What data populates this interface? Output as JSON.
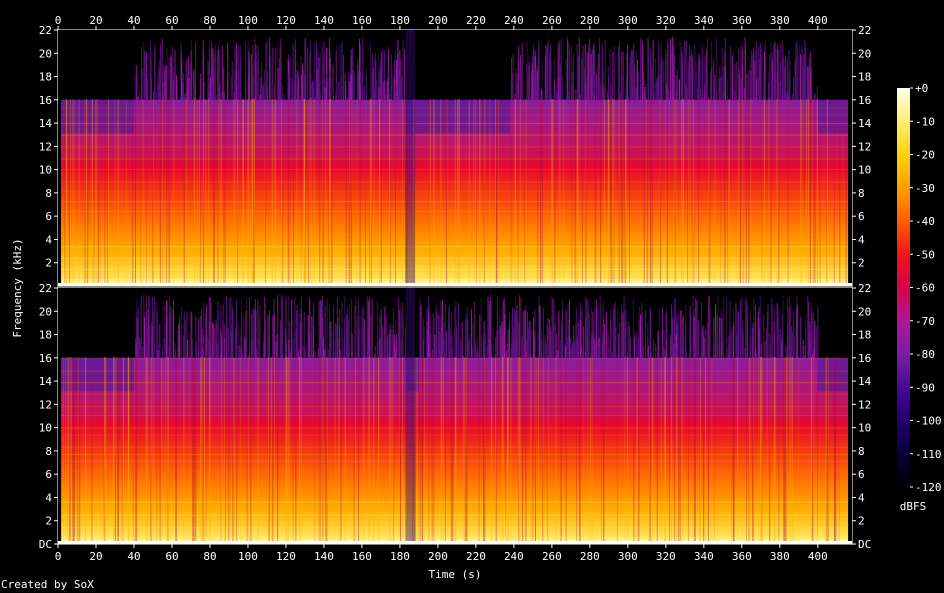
{
  "chart_data": {
    "type": "heatmap",
    "software_credit": "Created by SoX",
    "xlabel": "Time (s)",
    "ylabel": "Frequency (kHz)",
    "colorbar_label": "dBFS",
    "xlim": [
      0,
      418
    ],
    "x_ticks": [
      0,
      20,
      40,
      60,
      80,
      100,
      120,
      140,
      160,
      180,
      200,
      220,
      240,
      260,
      280,
      300,
      320,
      340,
      360,
      380,
      400
    ],
    "ylim_khz": [
      0,
      22
    ],
    "y_ticks": [
      {
        "value": 0,
        "label": "DC"
      },
      {
        "value": 2,
        "label": "2"
      },
      {
        "value": 4,
        "label": "4"
      },
      {
        "value": 6,
        "label": "6"
      },
      {
        "value": 8,
        "label": "8"
      },
      {
        "value": 10,
        "label": "10"
      },
      {
        "value": 12,
        "label": "12"
      },
      {
        "value": 14,
        "label": "14"
      },
      {
        "value": 16,
        "label": "16"
      },
      {
        "value": 18,
        "label": "18"
      },
      {
        "value": 20,
        "label": "20"
      },
      {
        "value": 22,
        "label": "22"
      }
    ],
    "colorbar_ticks": [
      {
        "value": 0,
        "label": "+0"
      },
      {
        "value": -10,
        "label": "-10"
      },
      {
        "value": -20,
        "label": "-20"
      },
      {
        "value": -30,
        "label": "-30"
      },
      {
        "value": -40,
        "label": "-40"
      },
      {
        "value": -50,
        "label": "-50"
      },
      {
        "value": -60,
        "label": "-60"
      },
      {
        "value": -70,
        "label": "-70"
      },
      {
        "value": -80,
        "label": "-80"
      },
      {
        "value": -90,
        "label": "-90"
      },
      {
        "value": -100,
        "label": "-100"
      },
      {
        "value": -110,
        "label": "-110"
      },
      {
        "value": -120,
        "label": "-120"
      }
    ],
    "colormap_stops": [
      {
        "db": -120,
        "color": "#000000"
      },
      {
        "db": -110,
        "color": "#06003a"
      },
      {
        "db": -95,
        "color": "#320088"
      },
      {
        "db": -80,
        "color": "#7a1ca8"
      },
      {
        "db": -70,
        "color": "#b01596"
      },
      {
        "db": -60,
        "color": "#d8004c"
      },
      {
        "db": -50,
        "color": "#f0141c"
      },
      {
        "db": -40,
        "color": "#ff5f00"
      },
      {
        "db": -30,
        "color": "#ffa000"
      },
      {
        "db": -20,
        "color": "#ffd10a"
      },
      {
        "db": -10,
        "color": "#ffee70"
      },
      {
        "db": 0,
        "color": "#fffff0"
      }
    ],
    "channels": [
      {
        "gaps": [
          {
            "from": 0,
            "to": 1.5
          },
          {
            "from": 416,
            "to": 418
          }
        ],
        "bandlimit_khz": [
          {
            "from": 1.5,
            "to": 40,
            "khz": 16
          },
          {
            "from": 40,
            "to": 183,
            "khz": 22
          },
          {
            "from": 183,
            "to": 238,
            "khz": 16
          },
          {
            "from": 238,
            "to": 400,
            "khz": 22
          },
          {
            "from": 400,
            "to": 416,
            "khz": 16
          }
        ]
      },
      {
        "gaps": [
          {
            "from": 0,
            "to": 1.5
          },
          {
            "from": 416,
            "to": 418
          }
        ],
        "bandlimit_khz": [
          {
            "from": 1.5,
            "to": 40,
            "khz": 16
          },
          {
            "from": 40,
            "to": 183,
            "khz": 22
          },
          {
            "from": 183,
            "to": 190,
            "khz": 16
          },
          {
            "from": 190,
            "to": 400,
            "khz": 22
          },
          {
            "from": 400,
            "to": 416,
            "khz": 16
          }
        ]
      }
    ]
  }
}
